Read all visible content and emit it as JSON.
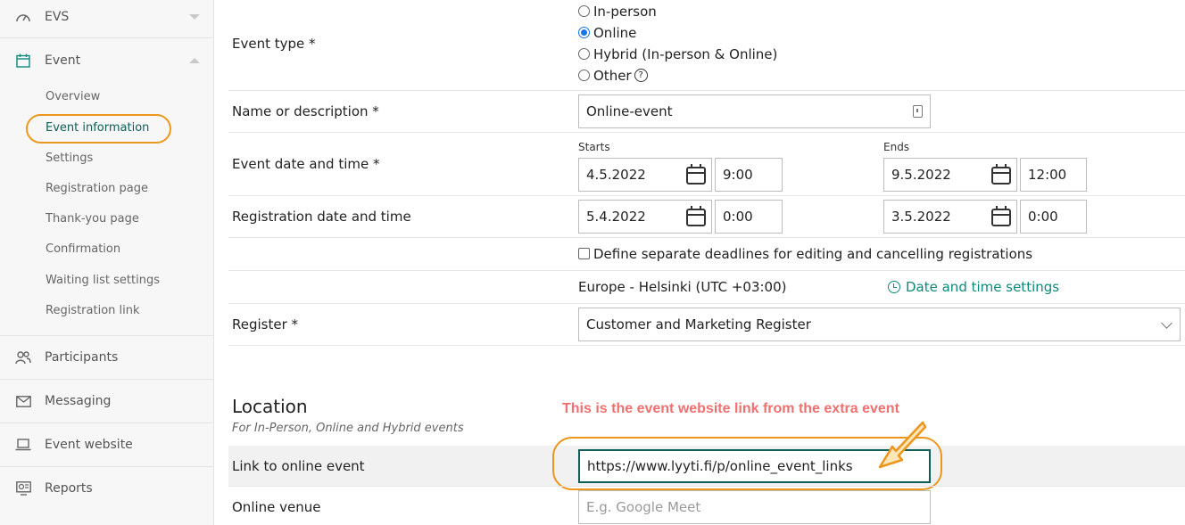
{
  "sidebar": {
    "evs_label": "EVS",
    "event_label": "Event",
    "sub_items": [
      "Overview",
      "Event information",
      "Settings",
      "Registration page",
      "Thank-you page",
      "Confirmation",
      "Waiting list settings",
      "Registration link"
    ],
    "participants_label": "Participants",
    "messaging_label": "Messaging",
    "website_label": "Event website",
    "reports_label": "Reports"
  },
  "form": {
    "event_type_label": "Event type *",
    "event_type_options": [
      "In-person",
      "Online",
      "Hybrid (In-person & Online)",
      "Other"
    ],
    "event_type_selected": "Online",
    "help_glyph": "?",
    "name_label": "Name or description *",
    "name_value": "Online-event",
    "datetime_label": "Event date and time *",
    "starts_label": "Starts",
    "ends_label": "Ends",
    "start_date": "4.5.2022",
    "start_time": "9:00",
    "end_date": "9.5.2022",
    "end_time": "12:00",
    "reg_label": "Registration date and time",
    "reg_start_date": "5.4.2022",
    "reg_start_time": "0:00",
    "reg_end_date": "3.5.2022",
    "reg_end_time": "0:00",
    "deadlines_checkbox_label": "Define separate deadlines for editing and cancelling registrations",
    "timezone": "Europe - Helsinki (UTC +03:00)",
    "datetime_settings_link": "Date and time settings",
    "register_label": "Register *",
    "register_value": "Customer and Marketing Register"
  },
  "location": {
    "title": "Location",
    "subtitle": "For In-Person, Online and Hybrid events",
    "annotation": "This is the event website link from the extra event",
    "online_link_label": "Link to online event",
    "online_link_value": "https://www.lyyti.fi/p/online_event_links",
    "venue_label": "Online venue",
    "venue_placeholder": "E.g. Google Meet"
  },
  "colors": {
    "accent": "#0d5e56",
    "highlight": "#ec961d",
    "annotation": "#f07070",
    "link": "#0d8a7a"
  }
}
